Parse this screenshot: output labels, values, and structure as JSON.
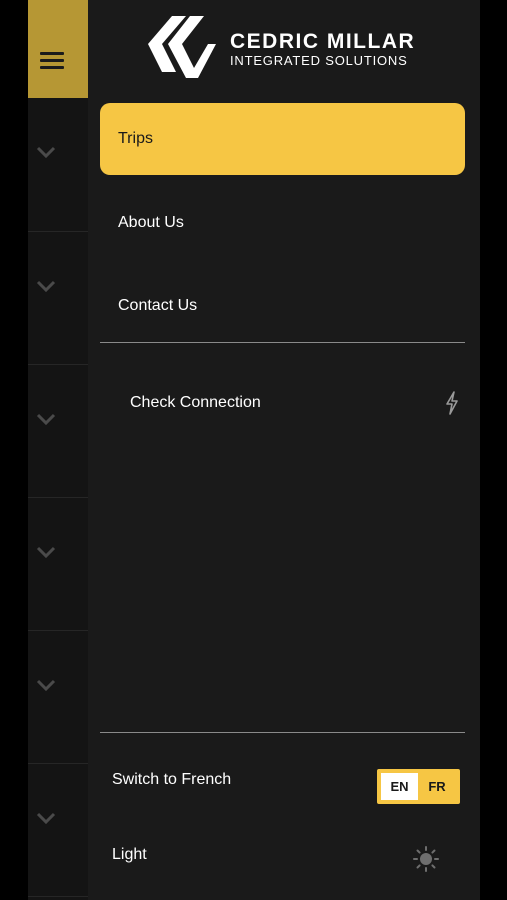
{
  "brand": {
    "title": "CEDRIC MILLAR",
    "subtitle": "INTEGRATED SOLUTIONS"
  },
  "nav": {
    "items": [
      {
        "label": "Trips",
        "active": true
      },
      {
        "label": "About Us",
        "active": false
      },
      {
        "label": "Contact Us",
        "active": false
      }
    ]
  },
  "connection": {
    "label": "Check Connection",
    "icon": "lightning-icon"
  },
  "settings": {
    "language_label": "Switch to French",
    "language_options": [
      "EN",
      "FR"
    ],
    "language_selected": "EN",
    "theme_label": "Light",
    "theme_icon": "sun-icon"
  },
  "colors": {
    "accent": "#f6c644",
    "menu_button": "#b69734",
    "drawer_bg": "#1a1a1a",
    "rail_bg": "#141414"
  }
}
